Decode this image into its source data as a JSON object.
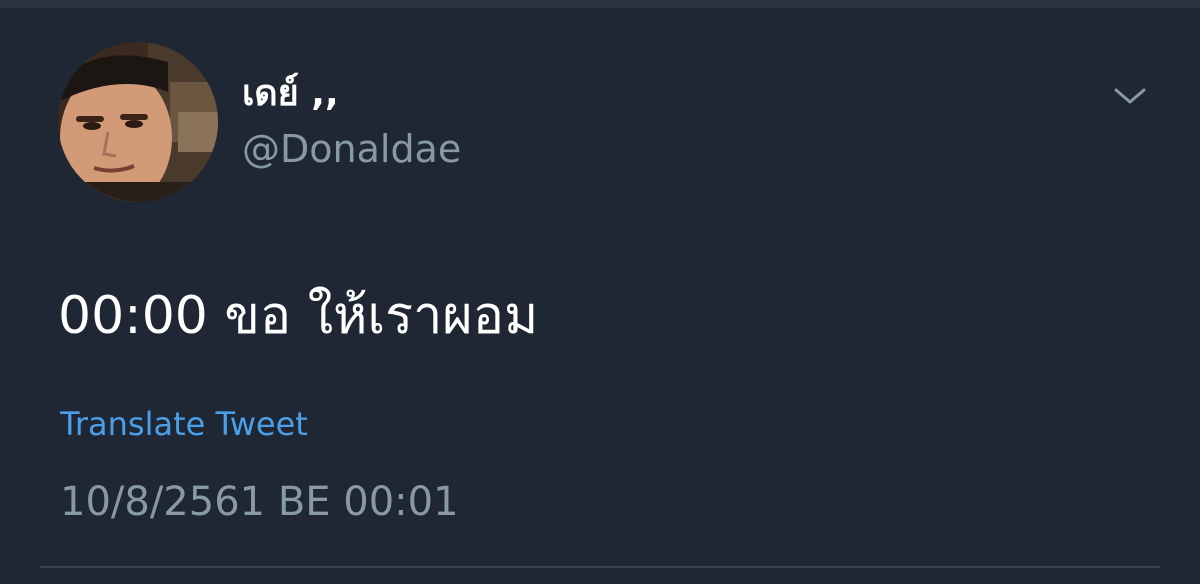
{
  "tweet": {
    "author": {
      "display_name": "เดย์ ,,",
      "handle": "@Donaldae",
      "avatar_icon": "profile-photo"
    },
    "text": "00:00 ขอ ให้เราผอม",
    "translate_label": "Translate Tweet",
    "timestamp": "10/8/2561 BE 00:01",
    "menu_icon": "chevron-down-icon"
  },
  "colors": {
    "background": "#1e2733",
    "primary_text": "#ffffff",
    "secondary_text": "#8899a6",
    "link": "#4a9fe8",
    "divider": "#38444d"
  }
}
